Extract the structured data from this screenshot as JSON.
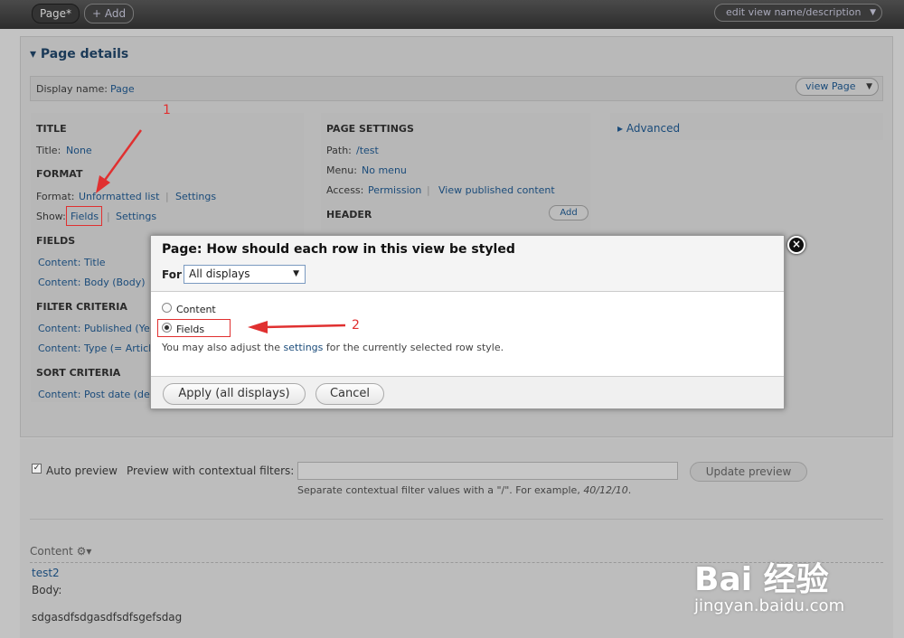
{
  "topbar": {
    "page_tab": "Page*",
    "add_tab": "+ Add",
    "edit_view": "edit view name/description"
  },
  "page_details": {
    "title": "Page details",
    "display_name_label": "Display name:",
    "display_name_value": "Page",
    "view_page_button": "view Page"
  },
  "col1": {
    "title_heading": "TITLE",
    "title_label": "Title:",
    "title_value": "None",
    "format_heading": "FORMAT",
    "format_label": "Format:",
    "format_value": "Unformatted list",
    "format_settings": "Settings",
    "show_label": "Show:",
    "show_value": "Fields",
    "show_settings": "Settings",
    "fields_heading": "FIELDS",
    "fields": [
      "Content: Title",
      "Content: Body (Body)"
    ],
    "filter_heading": "FILTER CRITERIA",
    "filters": [
      "Content: Published (Ye",
      "Content: Type (= Articl"
    ],
    "sort_heading": "SORT CRITERIA",
    "sorts": [
      "Content: Post date (des"
    ]
  },
  "col2": {
    "page_settings_heading": "PAGE SETTINGS",
    "path_label": "Path:",
    "path_value": "/test",
    "menu_label": "Menu:",
    "menu_value": "No menu",
    "access_label": "Access:",
    "access_value": "Permission",
    "access_value2": "View published content",
    "header_heading": "HEADER",
    "add_button": "Add"
  },
  "col3": {
    "advanced": "Advanced"
  },
  "annotations": {
    "one": "1",
    "two": "2"
  },
  "preview": {
    "auto_preview": "Auto preview",
    "contextual_label": "Preview with contextual filters:",
    "hint_prefix": "Separate contextual filter values with a \"/\". For example, ",
    "hint_example": "40/12/10",
    "hint_suffix": ".",
    "update_button": "Update preview",
    "content_label": "Content",
    "item_title": "test2",
    "item_body_label": "Body:",
    "item_body": "sdgasdfsdgasdfsdfsgefsdag"
  },
  "modal": {
    "title": "Page: How should each row in this view be styled",
    "for_label": "For",
    "for_value": "All displays",
    "option_content": "Content",
    "option_fields": "Fields",
    "note_prefix": "You may also adjust the ",
    "note_link": "settings",
    "note_suffix": " for the currently selected row style.",
    "apply_button": "Apply (all displays)",
    "cancel_button": "Cancel"
  },
  "watermark": {
    "logo": "Bai 经验",
    "url": "jingyan.baidu.com"
  }
}
